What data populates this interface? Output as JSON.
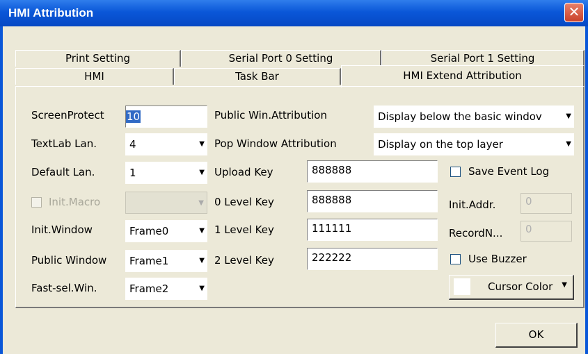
{
  "window": {
    "title": "HMI Attribution",
    "close_glyph": "✕"
  },
  "tabs": {
    "row1": [
      "Print Setting",
      "Serial Port 0 Setting",
      "Serial Port 1 Setting"
    ],
    "row2": [
      "HMI",
      "Task Bar",
      "HMI Extend Attribution"
    ],
    "active": "HMI Extend Attribution"
  },
  "form": {
    "screen_protect": {
      "label": "ScreenProtect",
      "value": "10"
    },
    "textlab_lan": {
      "label": "TextLab Lan.",
      "value": "4"
    },
    "default_lan": {
      "label": "Default Lan.",
      "value": "1"
    },
    "init_macro": {
      "label": "Init.Macro",
      "value": ""
    },
    "init_window": {
      "label": "Init.Window",
      "value": "Frame0"
    },
    "public_window": {
      "label": "Public Window",
      "value": "Frame1"
    },
    "fast_sel_win": {
      "label": "Fast-sel.Win.",
      "value": "Frame2"
    },
    "public_win_attr": {
      "label": "Public Win.Attribution",
      "value": "Display below the basic windov"
    },
    "pop_window_attr": {
      "label": "Pop Window Attribution",
      "value": "Display on the top layer"
    },
    "upload_key": {
      "label": "Upload Key",
      "value": "888888"
    },
    "level0_key": {
      "label": "0 Level Key",
      "value": "888888"
    },
    "level1_key": {
      "label": "1 Level Key",
      "value": "111111"
    },
    "level2_key": {
      "label": "2 Level Key",
      "value": "222222"
    },
    "save_event_log": {
      "label": "Save Event Log",
      "checked": false
    },
    "init_addr": {
      "label": "Init.Addr.",
      "value": "0"
    },
    "record_n": {
      "label": "RecordN...",
      "value": "0"
    },
    "use_buzzer": {
      "label": "Use Buzzer",
      "checked": false
    },
    "cursor_color": {
      "label": "Cursor Color",
      "swatch": "#ffffff"
    }
  },
  "buttons": {
    "ok": "OK"
  },
  "icons": {
    "dropdown": "▼"
  }
}
